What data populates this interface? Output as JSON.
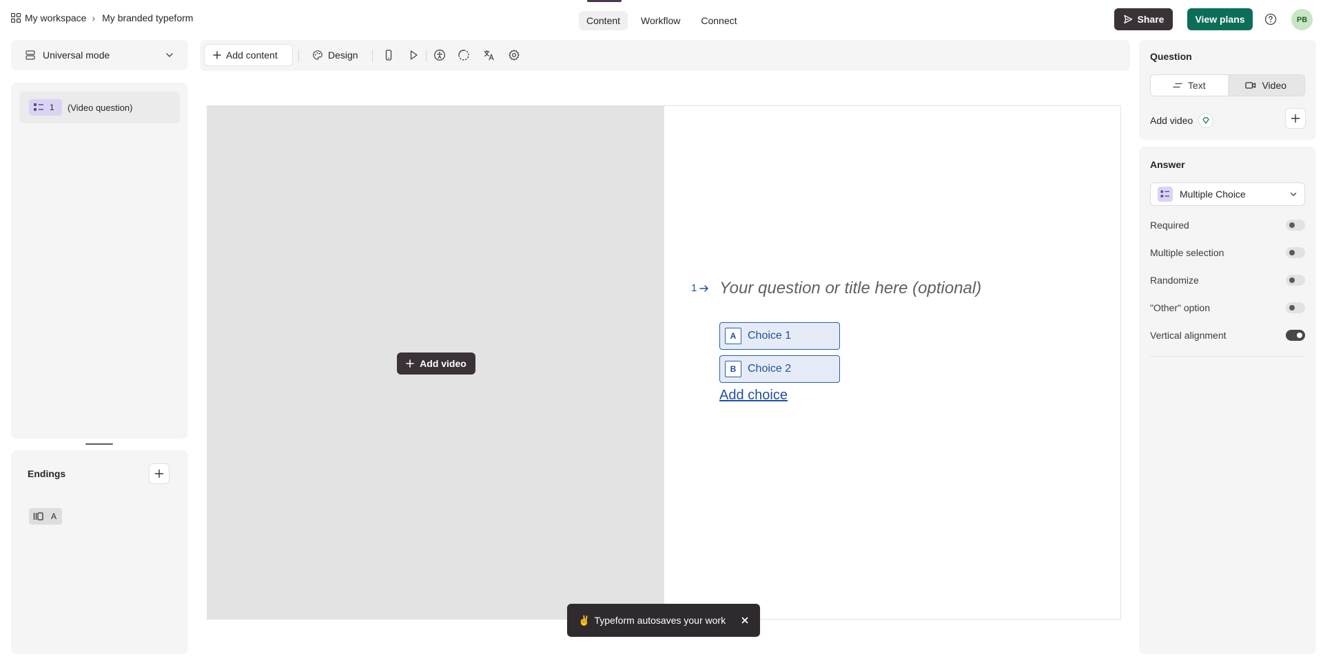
{
  "breadcrumb": {
    "workspace": "My workspace",
    "form": "My branded typeform"
  },
  "nav": {
    "tabs": [
      "Content",
      "Workflow",
      "Connect"
    ],
    "active": "Content"
  },
  "header": {
    "share_label": "Share",
    "view_plans_label": "View plans",
    "avatar_initials": "PB"
  },
  "left": {
    "mode_label": "Universal mode",
    "questions": [
      {
        "number": "1",
        "label": "(Video question)"
      }
    ],
    "endings_title": "Endings",
    "ending_badge": "A"
  },
  "toolbar": {
    "add_content_label": "Add content",
    "design_label": "Design"
  },
  "canvas": {
    "add_video_label": "Add video",
    "question_number": "1",
    "question_placeholder": "Your question or title here (optional)",
    "choices": [
      {
        "key": "A",
        "label": "Choice 1"
      },
      {
        "key": "B",
        "label": "Choice 2"
      }
    ],
    "add_choice_label": "Add choice"
  },
  "toast": {
    "emoji": "✌",
    "message": "Typeform autosaves your work"
  },
  "right": {
    "question_heading": "Question",
    "segment": {
      "options": [
        "Text",
        "Video"
      ],
      "active": "Video"
    },
    "add_video_label": "Add video",
    "answer_heading": "Answer",
    "answer_type": "Multiple Choice",
    "toggles": [
      {
        "label": "Required",
        "on": false
      },
      {
        "label": "Multiple selection",
        "on": false
      },
      {
        "label": "Randomize",
        "on": false
      },
      {
        "label": "\"Other\" option",
        "on": false
      },
      {
        "label": "Vertical alignment",
        "on": true
      }
    ]
  },
  "colors": {
    "dark": "#3a3237",
    "brand_green": "#0c6e58",
    "choice_blue": "#1f4f9e",
    "choice_bg": "#e5ecf8",
    "question_badge": "#dcd3f4"
  }
}
